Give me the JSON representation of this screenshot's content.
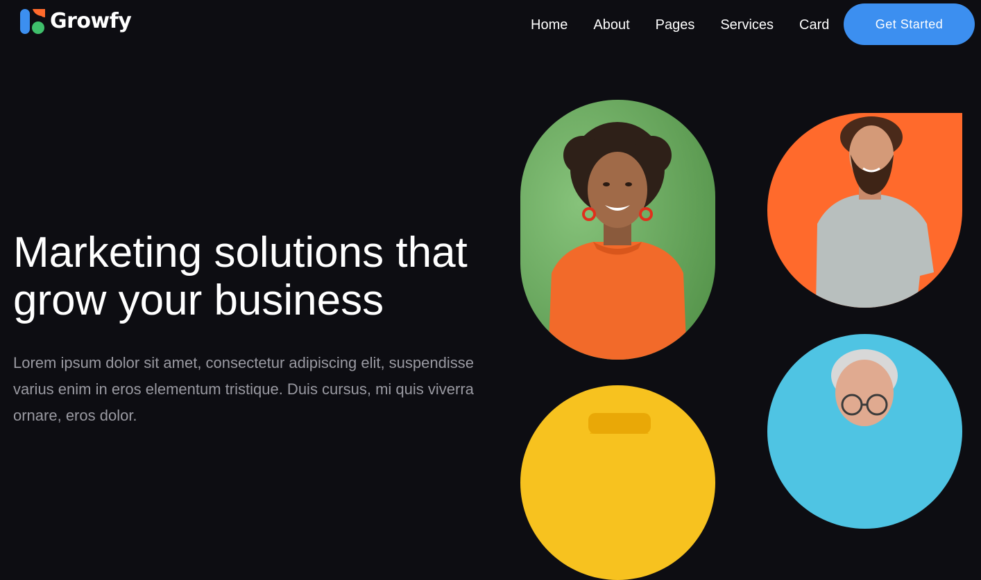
{
  "brand": {
    "name": "Growfy"
  },
  "nav": {
    "items": [
      "Home",
      "About",
      "Pages",
      "Services",
      "Card"
    ]
  },
  "cta": {
    "label": "Get Started"
  },
  "hero": {
    "title_line1": "Marketing solutions that",
    "title_line2": "grow your business",
    "description": "Lorem ipsum dolor sit amet, consectetur adipiscing elit, suspendisse varius enim in eros elementum tristique. Duis cursus, mi quis viverra ornare, eros dolor."
  },
  "colors": {
    "background": "#0d0d12",
    "accent": "#3c8ff0",
    "photo_green": "#6aa85e",
    "photo_orange": "#ff6a2c",
    "photo_blue": "#4fc4e3",
    "photo_yellow": "#f7c21f"
  },
  "photos": [
    {
      "name": "woman-green-background-photo"
    },
    {
      "name": "man-orange-background-photo"
    },
    {
      "name": "older-man-blue-background-photo"
    },
    {
      "name": "person-yellow-background-photo"
    }
  ]
}
